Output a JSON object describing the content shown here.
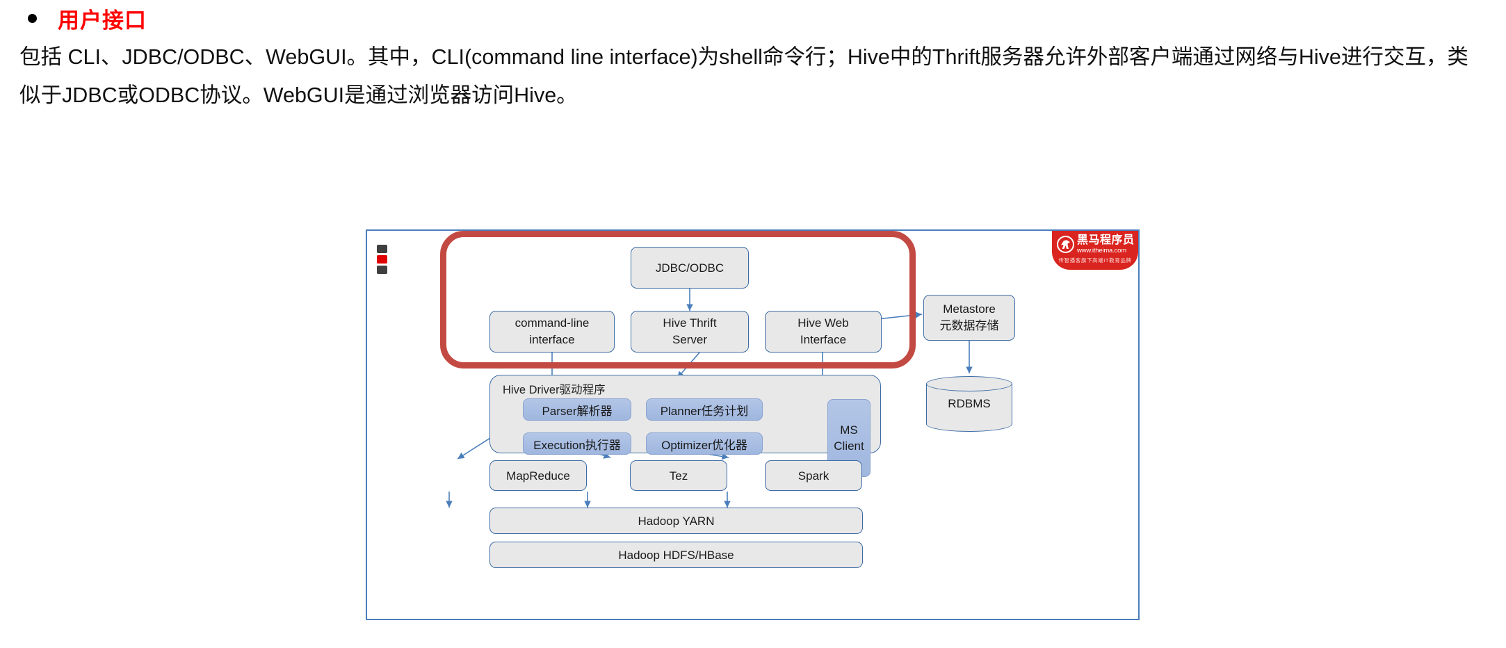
{
  "slide": {
    "heading": "用户接口",
    "paragraph": "包括 CLI、JDBC/ODBC、WebGUI。其中，CLI(command line interface)为shell命令行；Hive中的Thrift服务器允许外部客户端通过网络与Hive进行交互，类似于JDBC或ODBC协议。WebGUI是通过浏览器访问Hive。",
    "heading_color": "#ff0000"
  },
  "logo": {
    "brand_cn": "黑马程序员",
    "url": "www.itheima.com",
    "tagline": "传智播客旗下高端IT教育品牌",
    "background_color": "#d9241f"
  },
  "diagram": {
    "border_color": "#4a7ebb",
    "highlight_color": "#c34a42",
    "node_fill": "#e8e8e8",
    "node_border": "#3c6ba5",
    "sub_fill": "#b3c6e7",
    "nodes": {
      "jdbc_odbc": "JDBC/ODBC",
      "cli": "command-line\ninterface",
      "thrift": "Hive Thrift\nServer",
      "webui": "Hive Web\nInterface",
      "driver_title": "Hive Driver驱动程序",
      "parser": "Parser解析器",
      "planner": "Planner任务计划",
      "execution": "Execution执行器",
      "optimizer": "Optimizer优化器",
      "ms_client": "MS\nClient",
      "metastore": "Metastore\n元数据存储",
      "rdbms": "RDBMS",
      "mapreduce": "MapReduce",
      "tez": "Tez",
      "spark": "Spark",
      "yarn": "Hadoop YARN",
      "hdfs": "Hadoop HDFS/HBase"
    }
  }
}
